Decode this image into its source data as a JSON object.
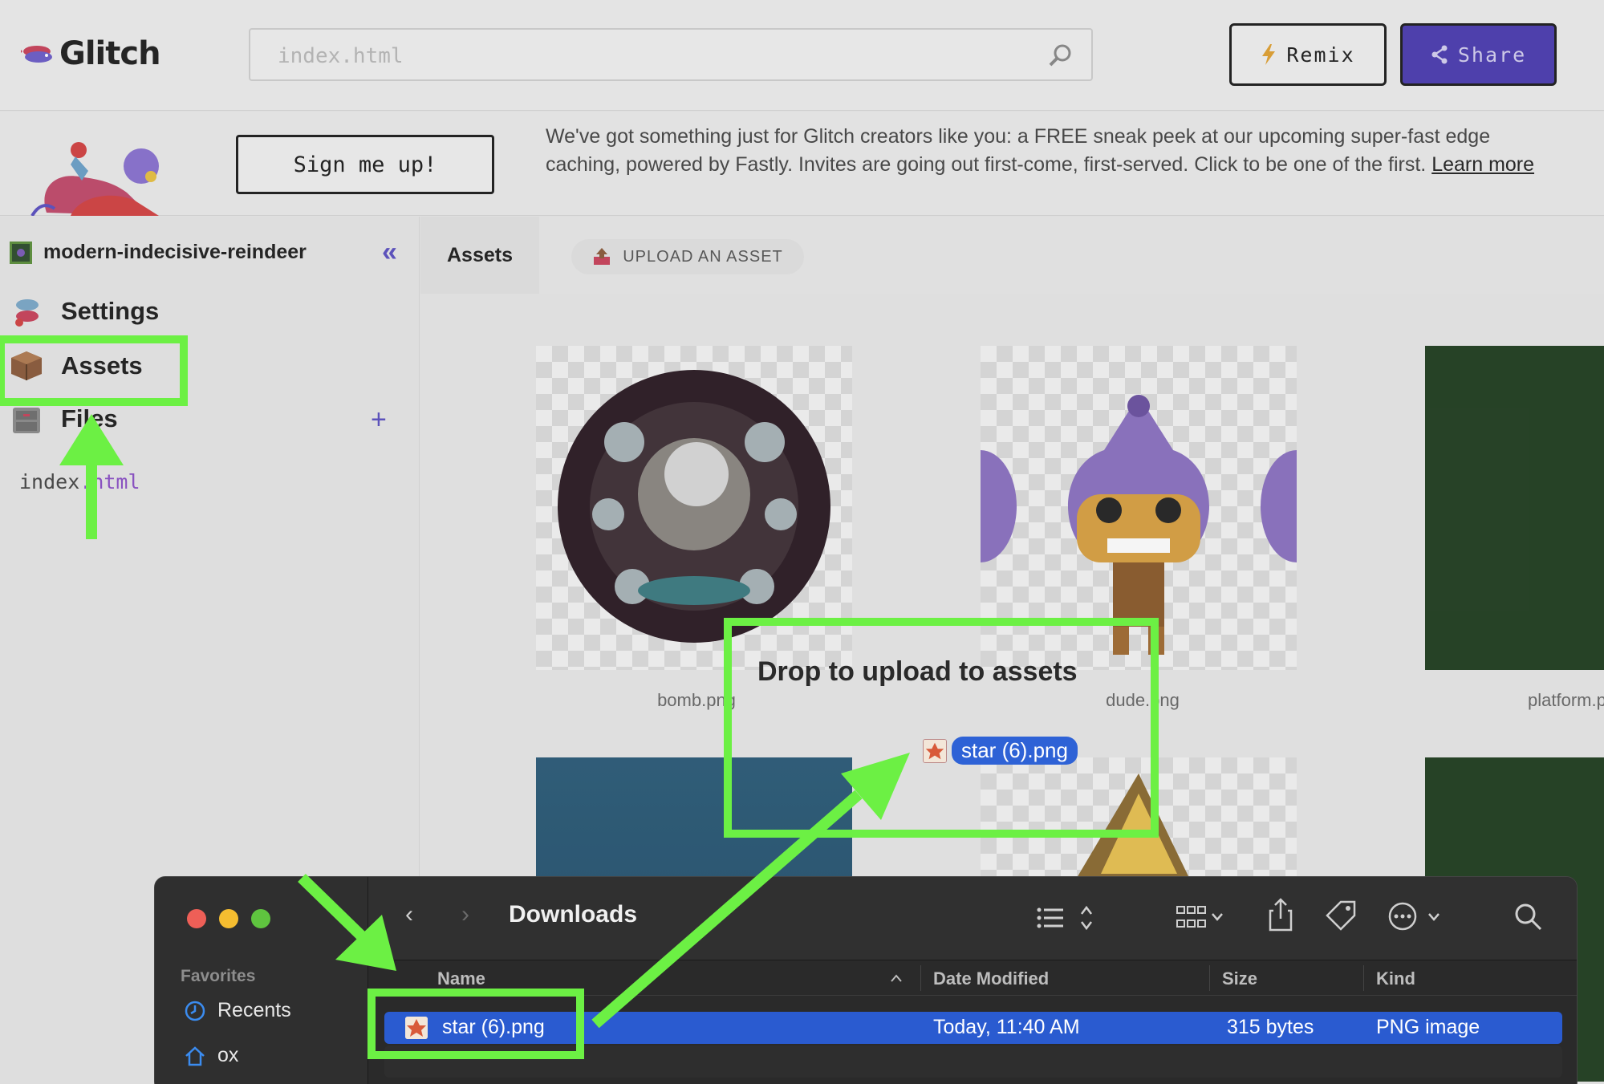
{
  "topbar": {
    "logo_text": "Glitch",
    "search_value": "index.html",
    "remix_label": "Remix",
    "share_label": "Share"
  },
  "banner": {
    "signup_label": "Sign me up!",
    "message": "We've got something just for Glitch creators like you: a FREE sneak peek at our upcoming super-fast edge caching, powered by Fastly. Invites are going out first-come, first-served. Click to be one of the first. ",
    "link_text": "Learn more"
  },
  "sidebar": {
    "project_name": "modern-indecisive-reindeer",
    "items": [
      {
        "label": "Settings",
        "icon": "settings-fish-icon"
      },
      {
        "label": "Assets",
        "icon": "box-icon"
      },
      {
        "label": "Files",
        "icon": "file-cabinet-icon"
      }
    ],
    "files": [
      {
        "name": "index",
        "ext": ".html"
      }
    ]
  },
  "main": {
    "tab_label": "Assets",
    "upload_label": "UPLOAD AN ASSET",
    "assets": [
      {
        "caption": "bomb.png"
      },
      {
        "caption": "dude.png"
      },
      {
        "caption": "platform.png"
      }
    ]
  },
  "drop_overlay": {
    "title": "Drop to upload to assets",
    "dragged_file": "star (6).png"
  },
  "finder": {
    "title": "Downloads",
    "favorites_heading": "Favorites",
    "sidebar_items": [
      {
        "label": "Recents",
        "icon": "clock-icon"
      },
      {
        "label": "ox",
        "icon": "home-icon"
      }
    ],
    "columns": {
      "name": "Name",
      "date": "Date Modified",
      "size": "Size",
      "kind": "Kind"
    },
    "rows": [
      {
        "name": "star (6).png",
        "date": "Today, 11:40 AM",
        "size": "315 bytes",
        "kind": "PNG image"
      }
    ]
  },
  "colors": {
    "annotation": "#6cf044",
    "share_button": "#4a3bb0",
    "selection": "#2a5bd0"
  }
}
